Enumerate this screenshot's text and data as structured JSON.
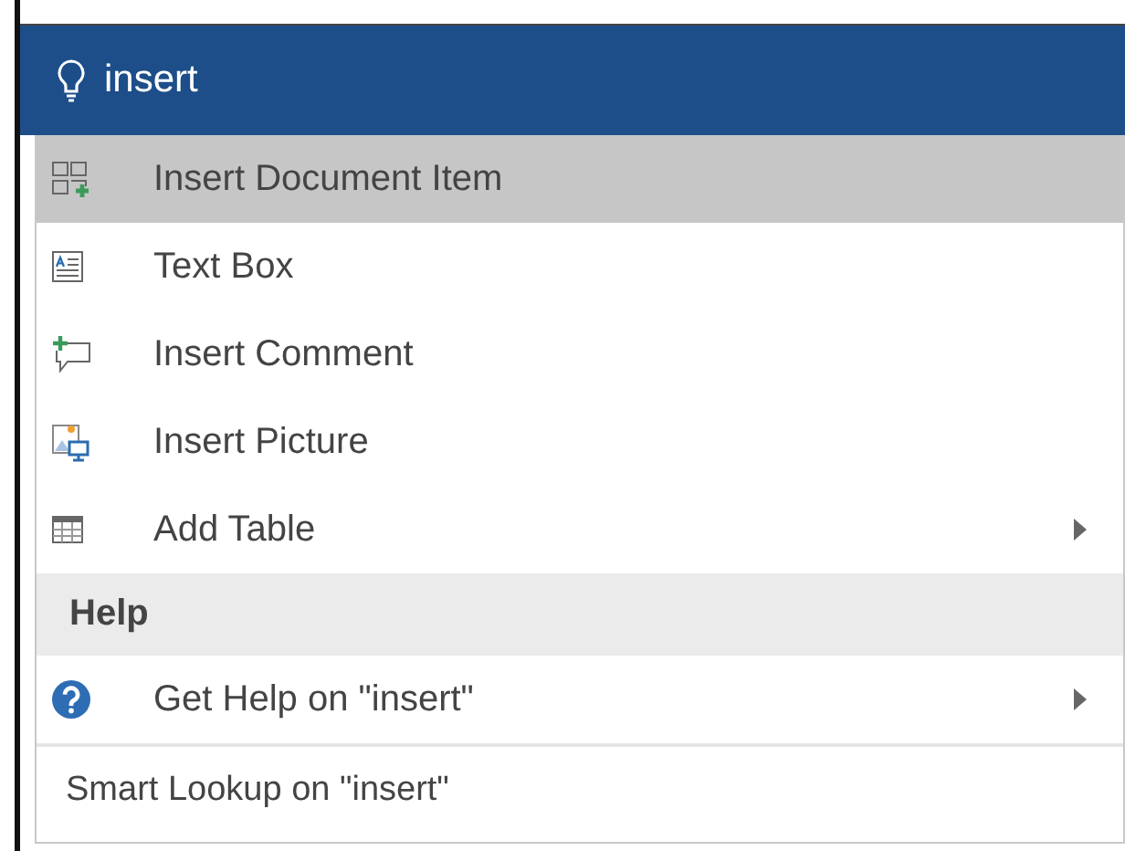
{
  "search": {
    "value": "insert"
  },
  "items": [
    {
      "label": "Insert Document Item",
      "kind": "document-item",
      "selected": true,
      "submenu": false
    },
    {
      "label": "Text Box",
      "kind": "text-box",
      "selected": false,
      "submenu": false
    },
    {
      "label": "Insert Comment",
      "kind": "comment",
      "selected": false,
      "submenu": false
    },
    {
      "label": "Insert Picture",
      "kind": "picture",
      "selected": false,
      "submenu": false
    },
    {
      "label": "Add Table",
      "kind": "table",
      "selected": false,
      "submenu": true
    }
  ],
  "help_section": {
    "title": "Help",
    "items": [
      {
        "label": "Get Help on \"insert\"",
        "kind": "help",
        "selected": false,
        "submenu": true
      }
    ]
  },
  "footer": {
    "label": "Smart Lookup on \"insert\""
  }
}
